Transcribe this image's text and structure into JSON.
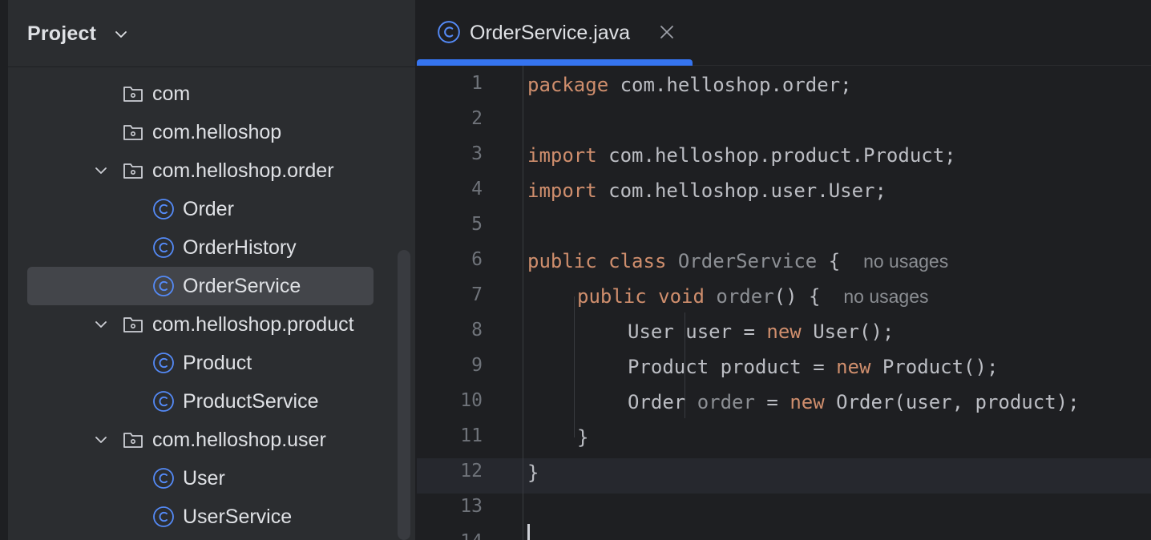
{
  "project_panel": {
    "title": "Project",
    "tree": [
      {
        "label": "com",
        "type": "package",
        "expanded": null
      },
      {
        "label": "com.helloshop",
        "type": "package",
        "expanded": null
      },
      {
        "label": "com.helloshop.order",
        "type": "package",
        "expanded": true
      },
      {
        "label": "Order",
        "type": "class",
        "expanded": null
      },
      {
        "label": "OrderHistory",
        "type": "class",
        "expanded": null
      },
      {
        "label": "OrderService",
        "type": "class",
        "expanded": null,
        "selected": true
      },
      {
        "label": "com.helloshop.product",
        "type": "package",
        "expanded": true
      },
      {
        "label": "Product",
        "type": "class",
        "expanded": null
      },
      {
        "label": "ProductService",
        "type": "class",
        "expanded": null
      },
      {
        "label": "com.helloshop.user",
        "type": "package",
        "expanded": true
      },
      {
        "label": "User",
        "type": "class",
        "expanded": null
      },
      {
        "label": "UserService",
        "type": "class",
        "expanded": null
      }
    ]
  },
  "editor": {
    "tab": {
      "label": "OrderService.java",
      "icon": "class-icon"
    },
    "line_numbers": [
      "1",
      "2",
      "3",
      "4",
      "5",
      "6",
      "7",
      "8",
      "9",
      "10",
      "11",
      "12",
      "13",
      "14"
    ],
    "code": {
      "l1": {
        "kw": "package",
        "rest": " com.helloshop.order;"
      },
      "l3": {
        "kw": "import",
        "rest": " com.helloshop.product.Product;"
      },
      "l4": {
        "kw": "import",
        "rest": " com.helloshop.user.User;"
      },
      "l6": {
        "kw1": "public",
        "kw2": "class",
        "name": "OrderService",
        "rest": " {",
        "hint": "no usages"
      },
      "l7": {
        "kw1": "public",
        "kw2": "void",
        "name": "order",
        "rest": "() {",
        "hint": "no usages"
      },
      "l8": {
        "a": "User user = ",
        "kw": "new",
        "b": " User();"
      },
      "l9": {
        "a": "Product product = ",
        "kw": "new",
        "b": " Product();"
      },
      "l10": {
        "a": "Order ",
        "dim": "order",
        "c": " = ",
        "kw": "new",
        "b": " Order(user, product);"
      },
      "l11": "}",
      "l12": "}"
    }
  },
  "colors": {
    "panel_bg": "#2b2d30",
    "editor_bg": "#1e1f22",
    "accent": "#3574f0",
    "keyword": "#cf8e6d",
    "class_icon": "#548af7"
  }
}
